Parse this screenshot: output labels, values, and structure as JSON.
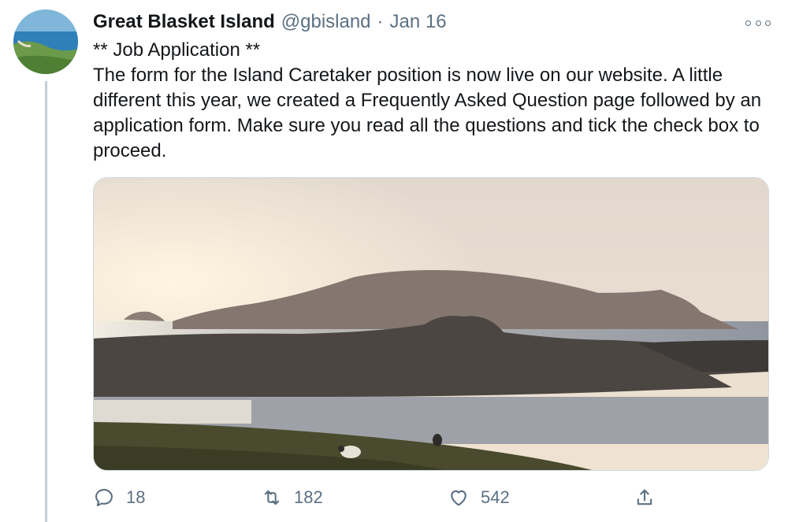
{
  "tweet": {
    "display_name": "Great Blasket Island",
    "handle": "@gbisland",
    "separator": "·",
    "date": "Jan 16",
    "heading": "** Job Application **",
    "body": "The form for the Island Caretaker position is now live on our website. A little different this year, we created a Frequently Asked Question page followed by an application form. Make sure you read all the questions and tick the check box to proceed."
  },
  "actions": {
    "reply_count": "18",
    "retweet_count": "182",
    "like_count": "542"
  },
  "icons": {
    "more": "more-options-icon",
    "reply": "reply-icon",
    "retweet": "retweet-icon",
    "like": "heart-icon",
    "share": "share-icon"
  },
  "colors": {
    "secondary_text": "#5b7083",
    "thread_line": "#c4cfd6"
  }
}
